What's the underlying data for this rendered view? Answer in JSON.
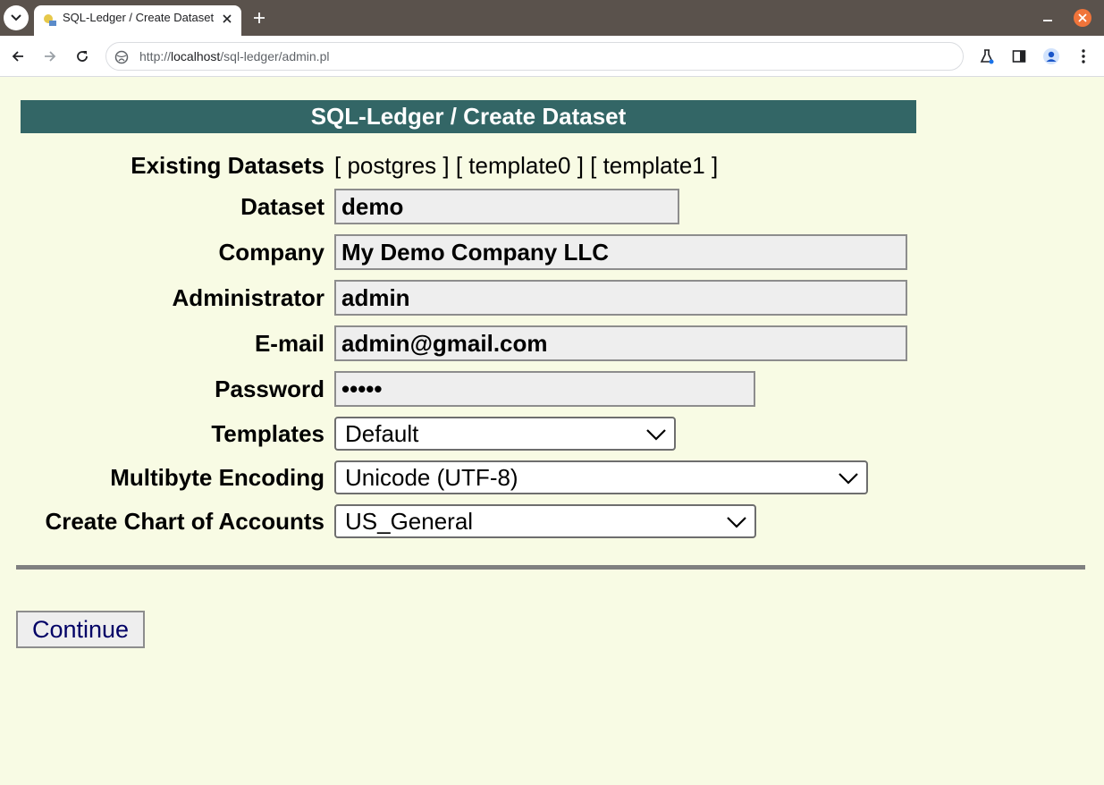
{
  "browser": {
    "tab_title": "SQL-Ledger / Create Dataset",
    "url_prefix": "http://",
    "url_host": "localhost",
    "url_path": "/sql-ledger/admin.pl",
    "icons": {
      "tab_list": "chevron-down-icon",
      "favicon": "sql-ledger-favicon",
      "tab_close": "close-icon",
      "new_tab": "plus-icon",
      "minimize": "minimize-icon",
      "window_close": "close-icon",
      "back": "arrow-left-icon",
      "forward": "arrow-right-icon",
      "reload": "reload-icon",
      "site_info": "site-info-icon",
      "labs": "flask-icon",
      "side_panel": "side-panel-icon",
      "profile": "profile-icon",
      "menu": "kebab-menu-icon"
    }
  },
  "page": {
    "title": "SQL-Ledger / Create Dataset",
    "existing_datasets_label": "Existing Datasets",
    "existing_datasets_value": "[ postgres ] [ template0 ] [ template1 ]",
    "dataset": {
      "label": "Dataset",
      "value": "demo"
    },
    "company": {
      "label": "Company",
      "value": "My Demo Company LLC"
    },
    "administrator": {
      "label": "Administrator",
      "value": "admin"
    },
    "email": {
      "label": "E-mail",
      "value": "admin@gmail.com"
    },
    "password": {
      "label": "Password",
      "value": "•••••"
    },
    "templates": {
      "label": "Templates",
      "value": "Default"
    },
    "encoding": {
      "label": "Multibyte Encoding",
      "value": "Unicode (UTF-8)"
    },
    "chart_of_accounts": {
      "label": "Create Chart of Accounts",
      "value": "US_General"
    },
    "continue_label": "Continue"
  },
  "colors": {
    "page_background": "#f8fbe4",
    "title_bar": "#336666",
    "input_background": "#eeeeee",
    "button_text": "#000066",
    "tabbar": "#5a524c",
    "window_close": "#f0743a"
  }
}
